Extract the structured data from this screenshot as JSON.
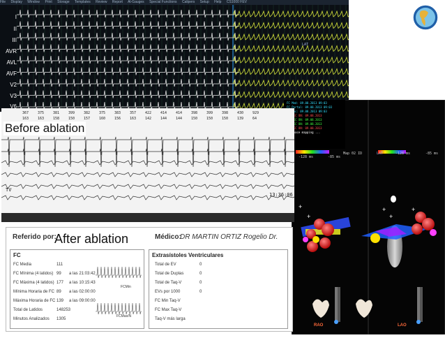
{
  "monitor": {
    "menu": [
      "File",
      "Display",
      "Window",
      "Print",
      "Storage",
      "Templates",
      "Review",
      "Report",
      "Al-Gauges",
      "Special Functions",
      "Calipers",
      "Setup",
      "Help",
      "CS1000 FEV"
    ],
    "leads": [
      "I",
      "II",
      "III",
      "AVR",
      "AVL",
      "AVF",
      "V2",
      "V3",
      "V6"
    ]
  },
  "before": {
    "label": "Before ablation",
    "interval_values": [
      "367",
      "375",
      "381",
      "399",
      "382",
      "375",
      "383",
      "357",
      "422",
      "414",
      "414",
      "398",
      "399",
      "398",
      "430",
      "929"
    ],
    "interval_sub": [
      "163",
      "163",
      "158",
      "150",
      "157",
      "160",
      "156",
      "163",
      "142",
      "144",
      "144",
      "150",
      "150",
      "150",
      "139",
      "64"
    ],
    "lead_label": "TV",
    "time": "13:36:06"
  },
  "map": {
    "left_header": "LAT",
    "right_header": "LAT",
    "right_view": "Map 02 ID",
    "left_scale": "-128 ms",
    "right_scale": "-128 ms",
    "left_scale_end": "-85 ms",
    "right_scale_end": "-85 ms",
    "left_view": "RAO",
    "right_view_bottom": "LAO",
    "event_lines": [
      "FC Med: 09.08.2013 09:03",
      "FC Portal: 09.08.2013 09:03",
      "FC loc: 09.08.2013 09:03",
      "FC REC ON: 09.08.2013",
      "FC REC ON: 09.08.2013",
      "FC REC ON: 09.08.2013",
      "FC REC ON: 09.08.2013",
      "OFF pace mapping ..."
    ]
  },
  "report": {
    "ref_label": "Referido por:",
    "after_label": "After ablation",
    "medico_label": "Médico:",
    "doctor": "DR MARTIN ORTIZ Rogelio Dr.",
    "fc_title": "FC",
    "fc_rows": [
      {
        "label": "FC Media",
        "value": "111",
        "extra": ""
      },
      {
        "label": "FC Mínima (4 latidos)",
        "value": "99",
        "extra": "a las  21:03:42"
      },
      {
        "label": "FC Máxima (4 latidos)",
        "value": "177",
        "extra": "a las  10:15:43"
      },
      {
        "label": "Mínima Horaria de FC",
        "value": "89",
        "extra": "a las  02:00:00"
      },
      {
        "label": "Máxima Horaria de FC",
        "value": "139",
        "extra": "a las  09:00:00"
      },
      {
        "label": "Total de Latidos",
        "value": "148253",
        "extra": ""
      },
      {
        "label": "Minutos Analizados",
        "value": "1305",
        "extra": ""
      }
    ],
    "fc_min_tag": "FCMin",
    "fc_max_tag": "FCMax/N",
    "ev_title": "Extrasístoles Ventriculares",
    "ev_rows": [
      {
        "label": "Total de EV",
        "value": "0"
      },
      {
        "label": "Total de Duplas",
        "value": "0"
      },
      {
        "label": "Total de Taq-V",
        "value": "0"
      },
      {
        "label": "EVs por 1000",
        "value": "0"
      },
      {
        "label": "FC Min Taq-V",
        "value": ""
      },
      {
        "label": "FC Max Taq-V",
        "value": ""
      },
      {
        "label": "Taq-V más larga",
        "value": ""
      }
    ]
  },
  "colors": {
    "monitor_bg": "#0b0f14",
    "trace_white": "#e6e6e6",
    "trace_yellow": "#d8e63c",
    "grid_green": "#1d3b2a",
    "strip_bg": "#f3f3f3"
  }
}
